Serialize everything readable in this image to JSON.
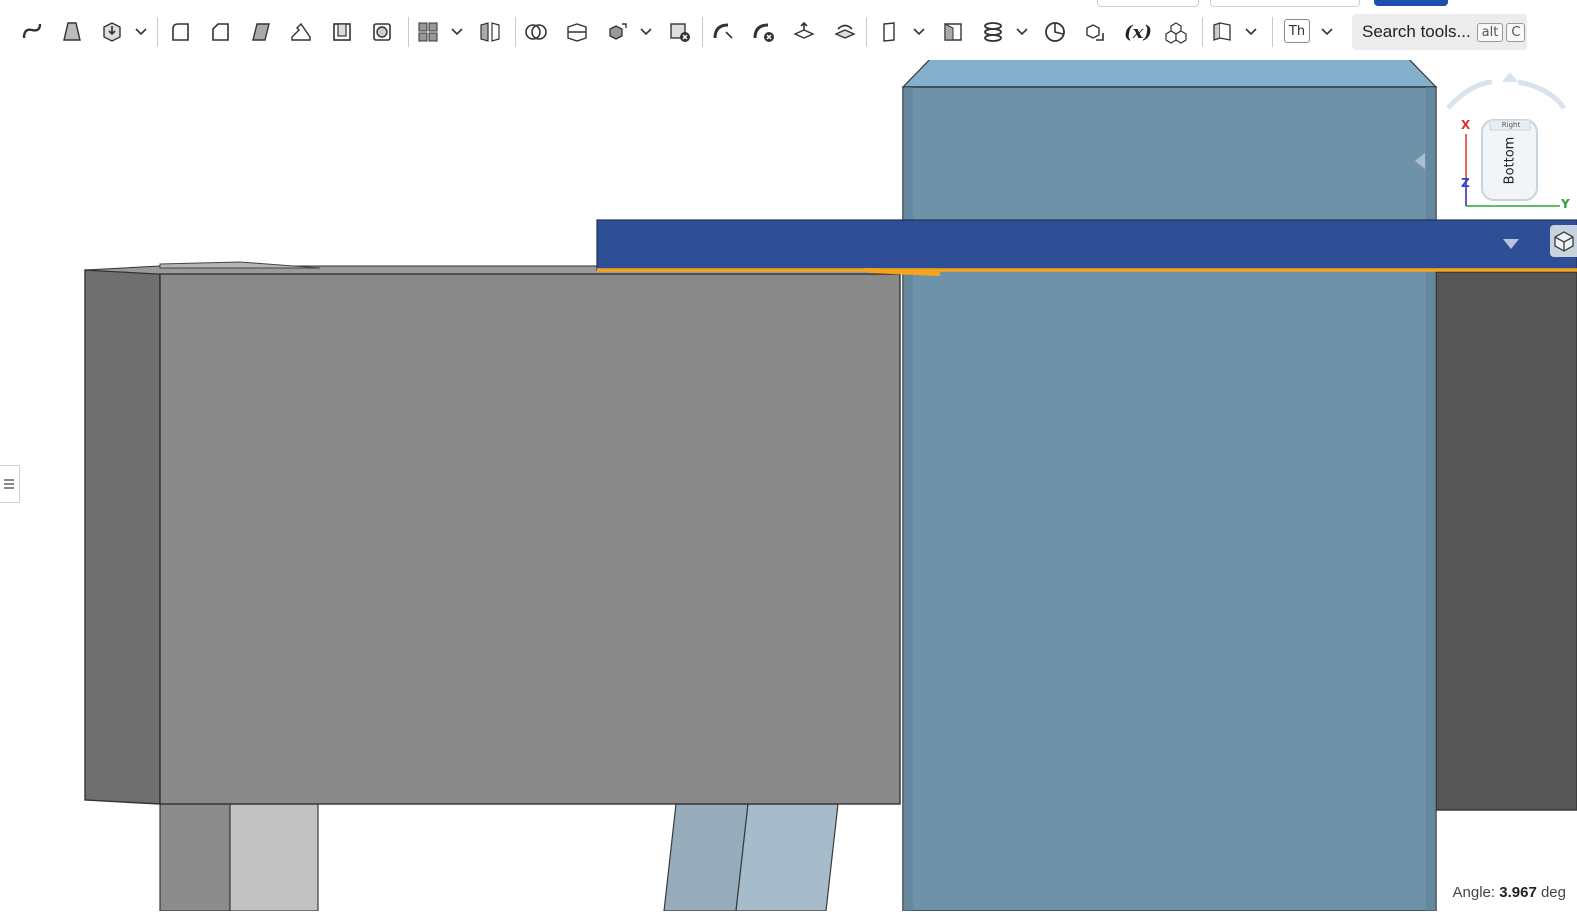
{
  "toolbar": {
    "search_label": "Search tools...",
    "search_shortcut_modifier": "alt",
    "search_shortcut_key": "C",
    "thicken_label": "Th",
    "variable_label": "(x)"
  },
  "viewport": {
    "angle_label": "Angle:",
    "angle_value": "3.967",
    "angle_unit": "deg"
  },
  "view_cube": {
    "face_front": "Bottom",
    "face_top": "Right",
    "axis_x": "X",
    "axis_y": "Y",
    "axis_z": "Z"
  },
  "colors": {
    "accent_blue": "#2e4f96",
    "body_blue": "#6e93a8",
    "body_blue_top": "#84b0cc",
    "body_gray": "#898989",
    "body_gray_side": "#6f6f6f",
    "body_dark": "#565656",
    "selection_orange": "#f4a51c",
    "axis_x": "#e0322b",
    "axis_y": "#2aa33a",
    "axis_z": "#3044c8"
  }
}
